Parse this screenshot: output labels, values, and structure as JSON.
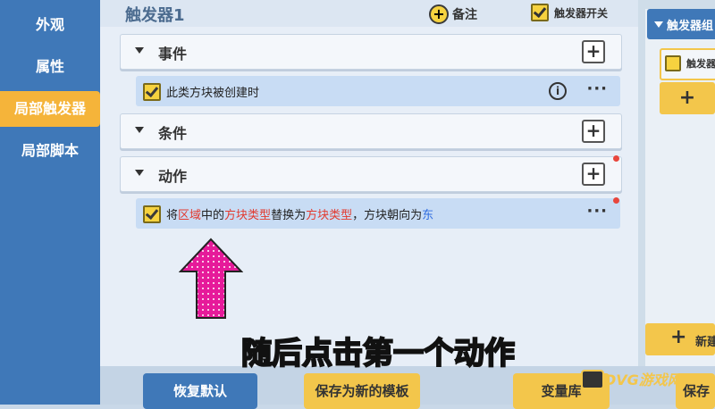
{
  "sidebar": {
    "items": [
      {
        "label": "外观"
      },
      {
        "label": "属性"
      },
      {
        "label": "局部触发器"
      },
      {
        "label": "局部脚本"
      }
    ]
  },
  "header": {
    "title": "触发器1",
    "note_label": "备注",
    "toggle_label": "触发器开关"
  },
  "sections": {
    "events": {
      "label": "事件"
    },
    "conditions": {
      "label": "条件"
    },
    "actions": {
      "label": "动作"
    }
  },
  "event_row": {
    "text": "此类方块被创建时"
  },
  "action_row": {
    "parts": [
      "将",
      "区域",
      "中的",
      "方块类型",
      "替换为",
      "方块类型",
      "，方块朝向为",
      "东"
    ]
  },
  "right_panel": {
    "header": "触发器组",
    "item_label": "触发器",
    "new_label": "新建"
  },
  "buttons": {
    "reset": "恢复默认",
    "save_template": "保存为新的模板",
    "variables": "变量库",
    "save": "保存"
  },
  "subtitle": "随后点击第一个动作",
  "watermark": "DVG游戏网",
  "colors": {
    "accent": "#f5b43a",
    "sidebar": "#3f78b8",
    "highlight_red": "#e23a2f",
    "highlight_blue": "#2f6de0",
    "arrow_pink": "#e61a9a"
  }
}
